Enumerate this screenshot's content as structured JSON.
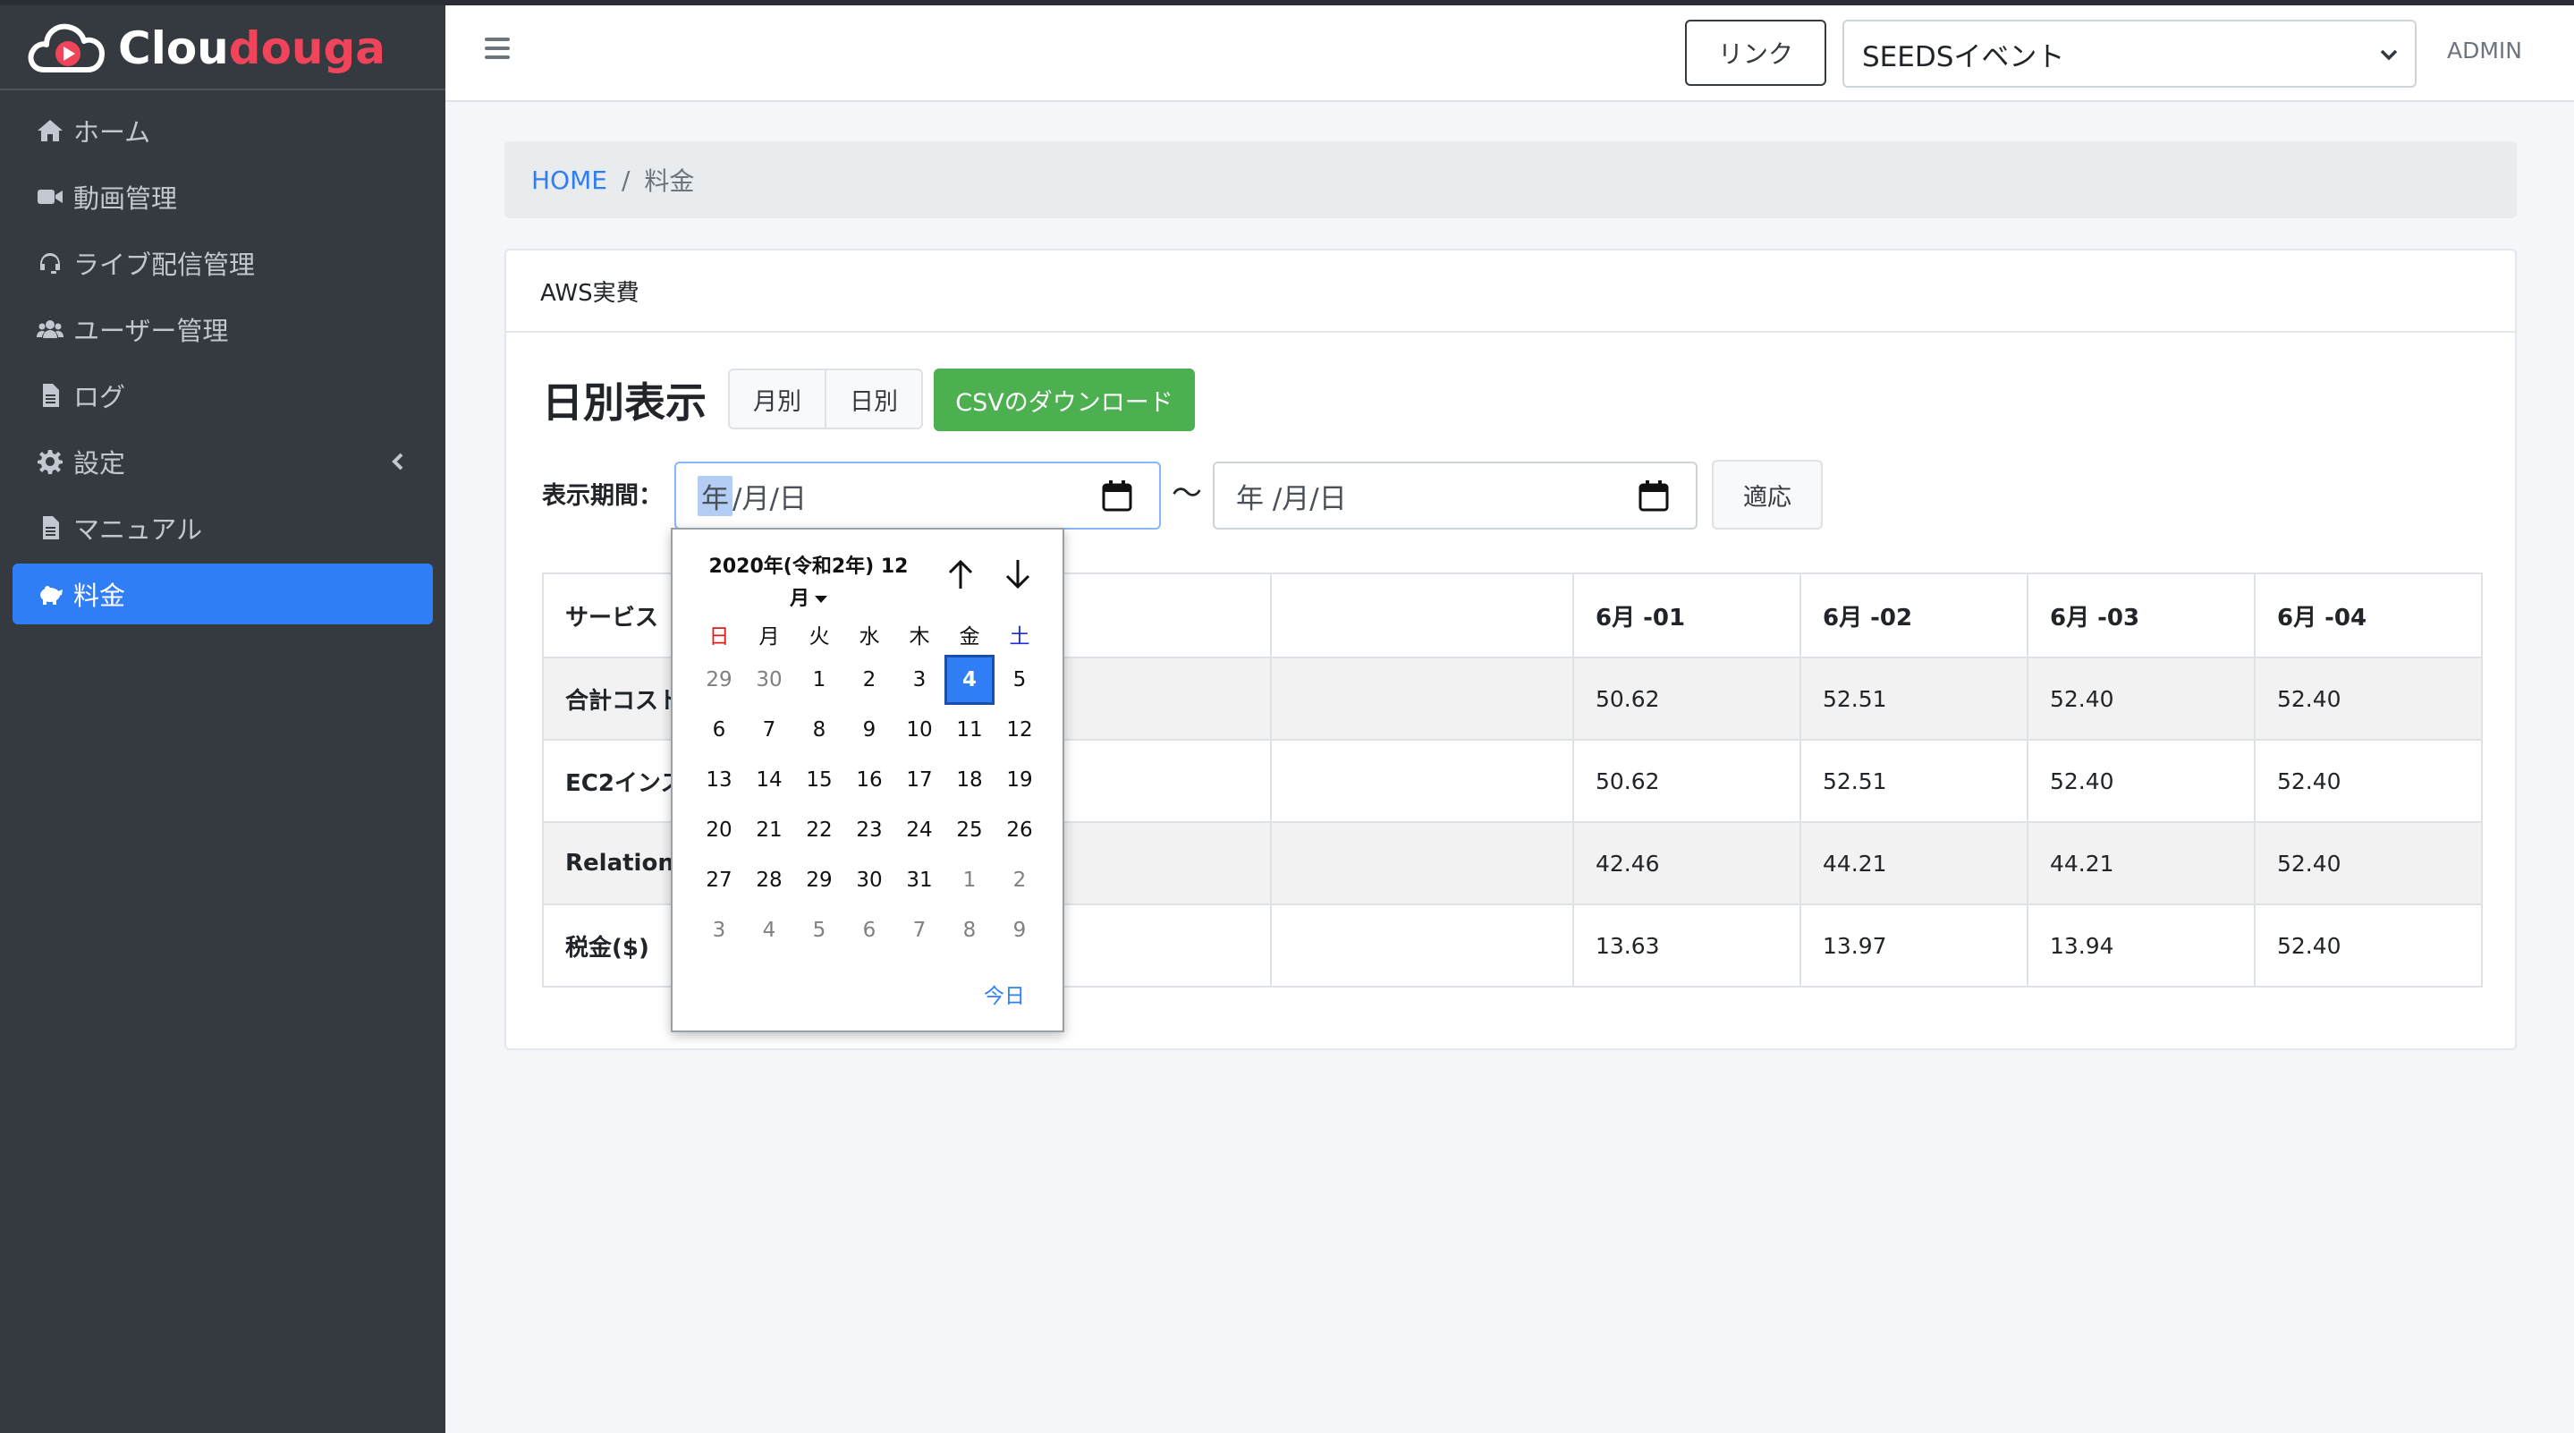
{
  "brand": {
    "prefix": "Clou",
    "accent": "douga",
    "accent_color": "#f0445b"
  },
  "sidebar": {
    "items": [
      {
        "label": "ホーム",
        "icon": "home-icon"
      },
      {
        "label": "動画管理",
        "icon": "video-camera-icon"
      },
      {
        "label": "ライブ配信管理",
        "icon": "headset-icon"
      },
      {
        "label": "ユーザー管理",
        "icon": "users-icon"
      },
      {
        "label": "ログ",
        "icon": "file-icon"
      },
      {
        "label": "設定",
        "icon": "gear-icon"
      },
      {
        "label": "マニュアル",
        "icon": "file-icon"
      },
      {
        "label": "料金",
        "icon": "piggy-bank-icon",
        "active": true
      }
    ]
  },
  "header": {
    "link_label": "リンク",
    "event_selected": "SEEDSイベント",
    "user": "ADMIN"
  },
  "breadcrumb": {
    "home": "HOME",
    "sep": "/",
    "current": "料金"
  },
  "card": {
    "title": "AWS実費",
    "heading": "日別表示",
    "btn_monthly": "月別",
    "btn_daily": "日別",
    "btn_csv": "CSVのダウンロード",
    "period_label": "表示期間：",
    "date_start": {
      "year": "年",
      "rest": "/月/日"
    },
    "date_end": "年 /月/日",
    "tilde": "〜",
    "apply": "適応"
  },
  "table": {
    "headers": [
      "サービス",
      "",
      "6月 -01",
      "6月 -02",
      "6月 -03",
      "6月 -04"
    ],
    "rows": [
      {
        "name": "合計コスト",
        "values": [
          "",
          "50.62",
          "52.51",
          "52.40",
          "52.40"
        ]
      },
      {
        "name": "EC2インス",
        "values": [
          "",
          "50.62",
          "52.51",
          "52.40",
          "52.40"
        ]
      },
      {
        "name": "Relational",
        "values": [
          "",
          "42.46",
          "44.21",
          "44.21",
          "52.40"
        ]
      },
      {
        "name": "税金($)",
        "values": [
          "",
          "13.63",
          "13.97",
          "13.94",
          "52.40"
        ]
      }
    ]
  },
  "calendar": {
    "title_line1": "2020年(令和2年) 12",
    "title_line2": "月",
    "weekdays": [
      "日",
      "月",
      "火",
      "水",
      "木",
      "金",
      "土"
    ],
    "weeks": [
      [
        "29",
        "30",
        "1",
        "2",
        "3",
        "4",
        "5"
      ],
      [
        "6",
        "7",
        "8",
        "9",
        "10",
        "11",
        "12"
      ],
      [
        "13",
        "14",
        "15",
        "16",
        "17",
        "18",
        "19"
      ],
      [
        "20",
        "21",
        "22",
        "23",
        "24",
        "25",
        "26"
      ],
      [
        "27",
        "28",
        "29",
        "30",
        "31",
        "1",
        "2"
      ],
      [
        "3",
        "4",
        "5",
        "6",
        "7",
        "8",
        "9"
      ]
    ],
    "selected": "4",
    "today_label": "今日"
  }
}
